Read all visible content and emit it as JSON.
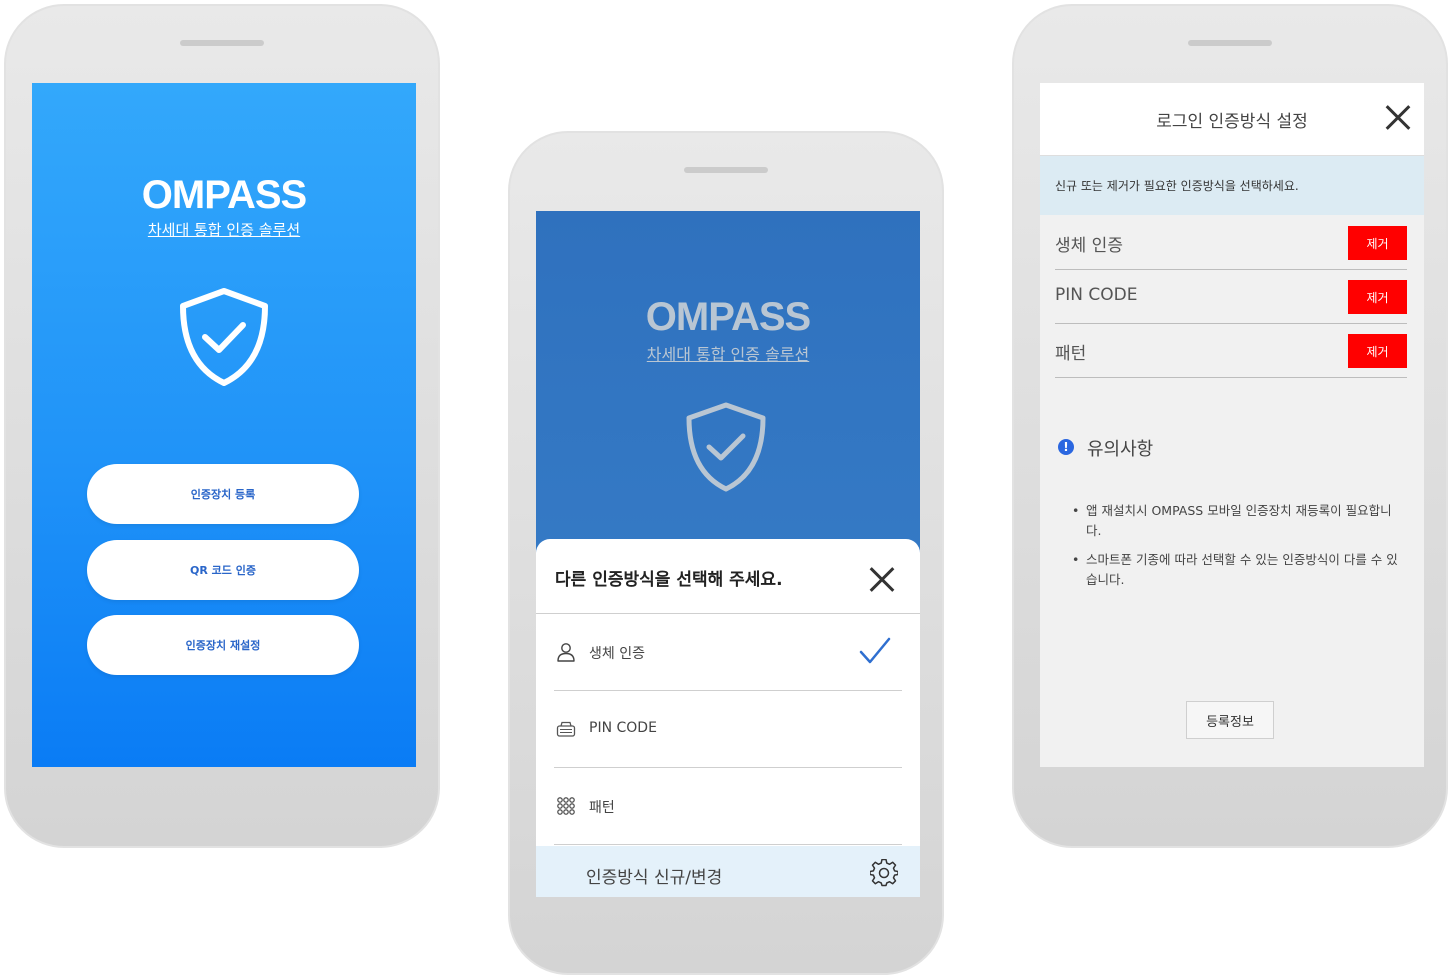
{
  "phone1": {
    "logo": "OMPASS",
    "tagline": "차세대 통합 인증 솔루션",
    "buttons": [
      "인증장치 등록",
      "QR 코드 인증",
      "인증장치 재설정"
    ]
  },
  "phone2": {
    "logo": "OMPASS",
    "tagline": "차세대 통합 인증 솔루션",
    "sheet_title": "다른 인증방식을 선택해 주세요.",
    "options": [
      {
        "label": "생체 인증",
        "icon": "user-icon",
        "selected": true
      },
      {
        "label": "PIN CODE",
        "icon": "keypad-icon",
        "selected": false
      },
      {
        "label": "패턴",
        "icon": "pattern-icon",
        "selected": false
      }
    ],
    "footer_label": "인증방식 신규/변경"
  },
  "phone3": {
    "title": "로그인 인증방식 설정",
    "notice": "신규 또는 제거가 필요한 인증방식을 선택하세요.",
    "rows": [
      {
        "label": "생체 인증",
        "action": "제거"
      },
      {
        "label": "PIN CODE",
        "action": "제거"
      },
      {
        "label": "패턴",
        "action": "제거"
      }
    ],
    "caution_title": "유의사항",
    "caution_items": [
      "앱 재설치시 OMPASS 모바일 인증장치 재등록이 필요합니다.",
      "스마트폰 기종에 따라 선택할 수 있는 인증방식이 다를 수 있습니다."
    ],
    "register_button": "등록정보"
  },
  "colors": {
    "primary_blue": "#2093f8",
    "dark_blue": "#2f71be",
    "remove_red": "#ff0000",
    "notice_bg": "#dcebf3"
  }
}
